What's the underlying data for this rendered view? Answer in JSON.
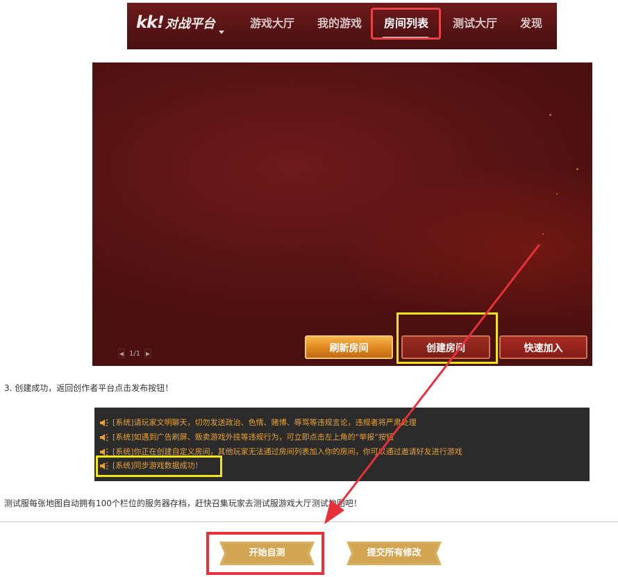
{
  "navbar": {
    "logo_kk": "kk!",
    "logo_text": "对战平台",
    "items": [
      {
        "label": "游戏大厅"
      },
      {
        "label": "我的游戏"
      },
      {
        "label": "房间列表"
      },
      {
        "label": "测试大厅"
      },
      {
        "label": "发现"
      }
    ],
    "active_index": 2
  },
  "game_panel": {
    "pager_text": "1/1",
    "buttons": {
      "refresh": "刷新房间",
      "create": "创建房间",
      "quick_join": "快速加入"
    }
  },
  "step_text": "3. 创建成功，返回创作者平台点击发布按钮！",
  "chat": {
    "lines": [
      "[系统]请玩家文明聊天，切勿发送政治、色情、赌博、辱骂等违规言论，违规者将严肃处理",
      "[系统]如遇到广告刷屏、贩卖游戏外挂等违规行为，可立即点击左上角的“举报”按钮",
      "[系统]你正在创建自定义房间，其他玩家无法通过房间列表加入你的房间，你可以通过邀请好友进行游戏",
      "[系统]同步游戏数据成功！"
    ]
  },
  "info_text": "测试服每张地图自动拥有100个栏位的服务器存档，赶快召集玩家去测试服游戏大厅测试地图吧！",
  "actions": {
    "start_test": "开始自测",
    "submit_all": "提交所有修改"
  },
  "colors": {
    "highlight_red": "#e8303a",
    "highlight_yellow": "#f2e812",
    "chat_text": "#e9a235",
    "gold": "#d9b062"
  }
}
